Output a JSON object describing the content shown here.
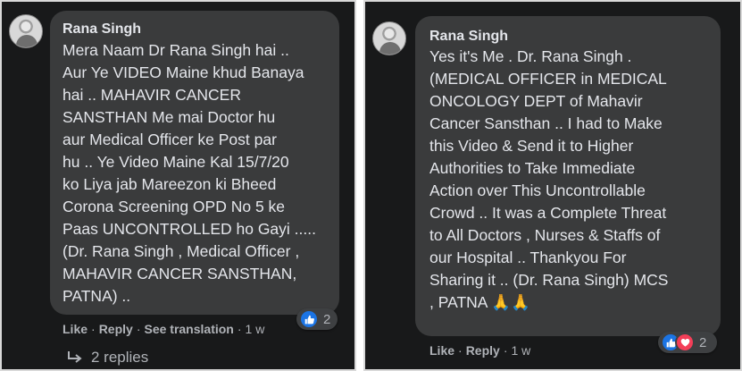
{
  "left_comment": {
    "author": "Rana Singh",
    "text": "Mera Naam Dr Rana Singh hai ..\nAur Ye VIDEO Maine khud Banaya\nhai .. MAHAVIR CANCER\nSANSTHAN Me mai Doctor hu\naur Medical Officer ke Post par\nhu .. Ye Video Maine Kal 15/7/20\nko Liya jab Mareezon ki Bheed\nCorona Screening OPD No 5 ke\nPaas UNCONTROLLED ho Gayi .....\n(Dr. Rana Singh , Medical Officer ,\nMAHAVIR CANCER SANSTHAN,\nPATNA) ..",
    "actions": {
      "like": "Like",
      "reply": "Reply",
      "see_translation": "See translation",
      "time": "1 w"
    },
    "reactions": {
      "icons": [
        "like-icon"
      ],
      "count": "2"
    },
    "replies_label": "2 replies"
  },
  "right_comment": {
    "author": "Rana Singh",
    "text": "Yes it's Me . Dr. Rana Singh .\n(MEDICAL OFFICER in MEDICAL\nONCOLOGY DEPT of Mahavir\nCancer Sansthan .. I had to Make\nthis Video & Send it to Higher\nAuthorities to Take Immediate\nAction over This Uncontrollable\nCrowd .. It was a Complete Threat\nto All Doctors , Nurses & Staffs of\nour Hospital .. Thankyou For\nSharing it .. (Dr. Rana Singh) MCS\n, PATNA 🙏🙏",
    "actions": {
      "like": "Like",
      "reply": "Reply",
      "time": "1 w"
    },
    "reactions": {
      "icons": [
        "like-icon",
        "love-icon"
      ],
      "count": "2"
    }
  },
  "colors": {
    "background": "#18191a",
    "bubble": "#3a3b3c",
    "text": "#e4e6eb",
    "secondary_text": "#b0b3b8",
    "like_blue": "#1b74e4",
    "love_red": "#f33e58"
  }
}
